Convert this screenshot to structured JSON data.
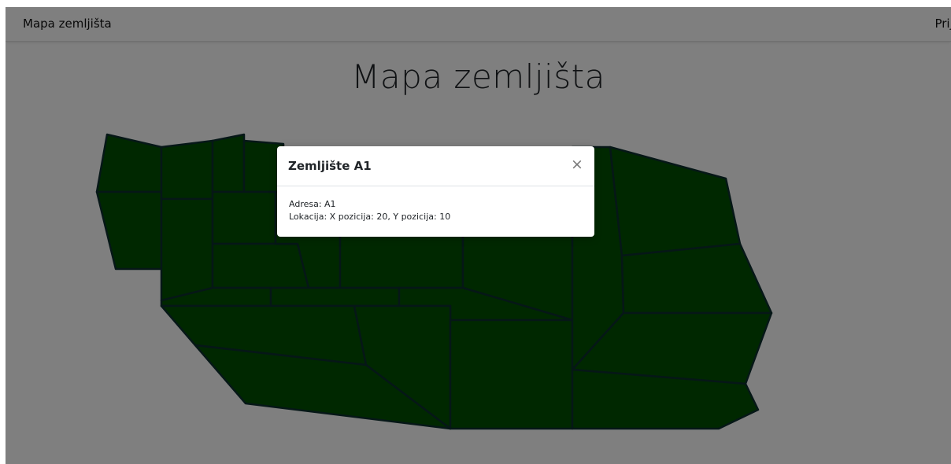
{
  "navbar": {
    "brand": "Mapa zemljišta",
    "login": "Prijava"
  },
  "page": {
    "title": "Mapa zemljišta"
  },
  "colors": {
    "parcel_fill": "#005000",
    "parcel_stroke": "#0c2f2f",
    "backdrop": "rgba(0,0,0,0.5)"
  },
  "modal": {
    "title": "Zemljište A1",
    "close_symbol": "×",
    "address": "Adresa: A1",
    "location": "Lokacija: X pozicija: 20, Y pozicija: 10"
  }
}
